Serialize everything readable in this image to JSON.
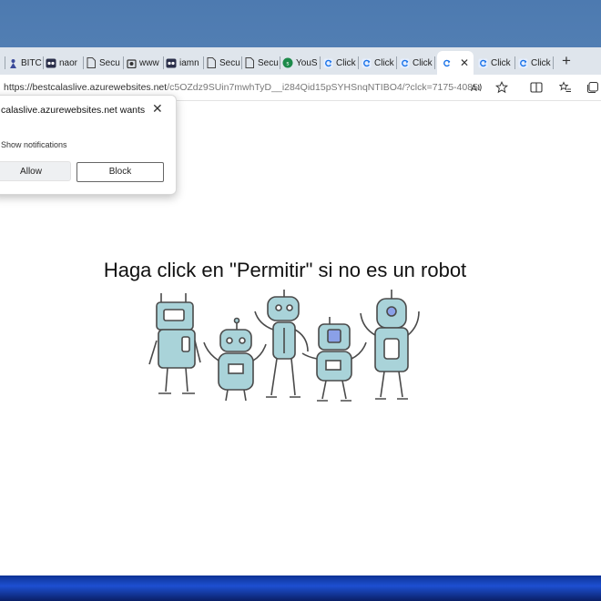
{
  "tabs": [
    {
      "label": "",
      "icon": "page-icon"
    },
    {
      "label": "BITC",
      "icon": "figure-icon"
    },
    {
      "label": "naor",
      "icon": "media-icon"
    },
    {
      "label": "Secu",
      "icon": "page-icon"
    },
    {
      "label": "www",
      "icon": "bag-icon"
    },
    {
      "label": "iamn",
      "icon": "media-icon"
    },
    {
      "label": "Secu",
      "icon": "page-icon"
    },
    {
      "label": "Secu",
      "icon": "page-icon"
    },
    {
      "label": "YouS",
      "icon": "green-circle-icon"
    },
    {
      "label": "Click",
      "icon": "refresh-icon"
    },
    {
      "label": "Click",
      "icon": "refresh-icon"
    },
    {
      "label": "Click",
      "icon": "refresh-icon"
    },
    {
      "label": "",
      "icon": "refresh-icon",
      "active": true
    },
    {
      "label": "Click",
      "icon": "refresh-icon"
    },
    {
      "label": "Click",
      "icon": "refresh-icon"
    }
  ],
  "address": {
    "url_host": "https://bestcalaslive.azurewebsites.net",
    "url_rest": "/c5OZdz9SUin7mwhTyD__i284Qid15pSYHSnqNTIBO4/?clck=7175-4085..."
  },
  "popup": {
    "title": "calaslive.azurewebsites.net wants",
    "text": "Show notifications",
    "allow_label": "Allow",
    "block_label": "Block",
    "close_glyph": "✕"
  },
  "page": {
    "headline": "Haga click en \"Permitir\" si no es un robot"
  },
  "colors": {
    "robot_fill": "#a9d3d9",
    "robot_stroke": "#4a4a4a",
    "accent_blue": "#1a73e8"
  }
}
